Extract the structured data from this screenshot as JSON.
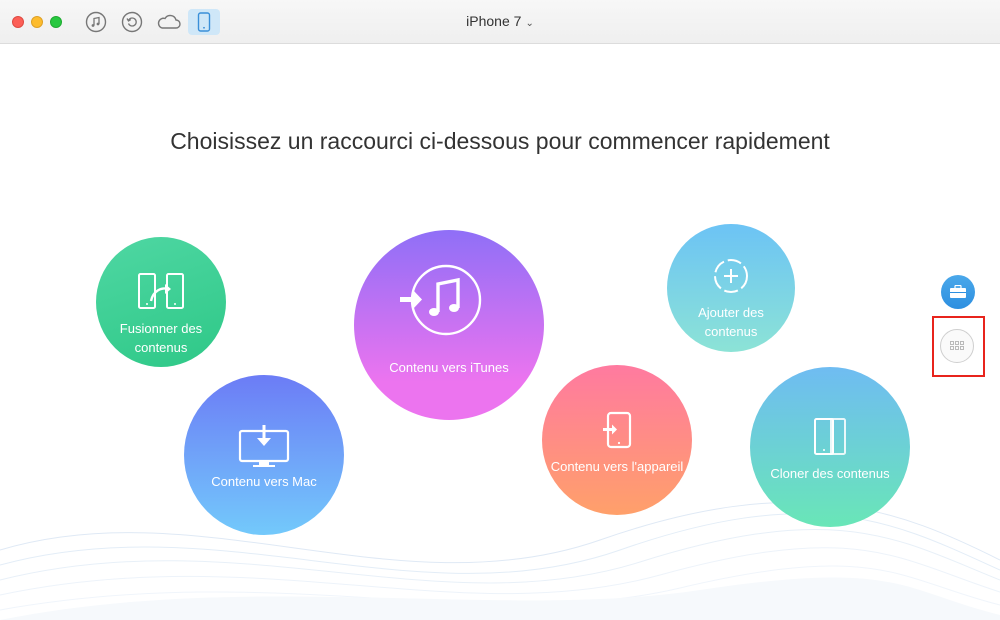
{
  "toolbar": {
    "icons": [
      "music-icon",
      "restore-icon",
      "cloud-icon",
      "phone-icon"
    ],
    "device_name": "iPhone 7",
    "device_chevron": "⌄"
  },
  "main": {
    "headline": "Choisissez un raccourci ci-dessous pour commencer rapidement"
  },
  "shortcuts": [
    {
      "label_line1": "Fusionner des",
      "label_line2": "contenus",
      "icon": "merge-icon"
    },
    {
      "label": "Contenu vers Mac",
      "icon": "monitor-download-icon"
    },
    {
      "label": "Contenu vers iTunes",
      "icon": "itunes-icon"
    },
    {
      "label": "Contenu vers l'appareil",
      "icon": "phone-import-icon"
    },
    {
      "label_line1": "Ajouter des",
      "label_line2": "contenus",
      "icon": "add-circle-icon"
    },
    {
      "label": "Cloner des contenus",
      "icon": "clone-icon"
    }
  ],
  "colors": {
    "highlight": "#e8241c",
    "accent": "#2d8fe0"
  }
}
